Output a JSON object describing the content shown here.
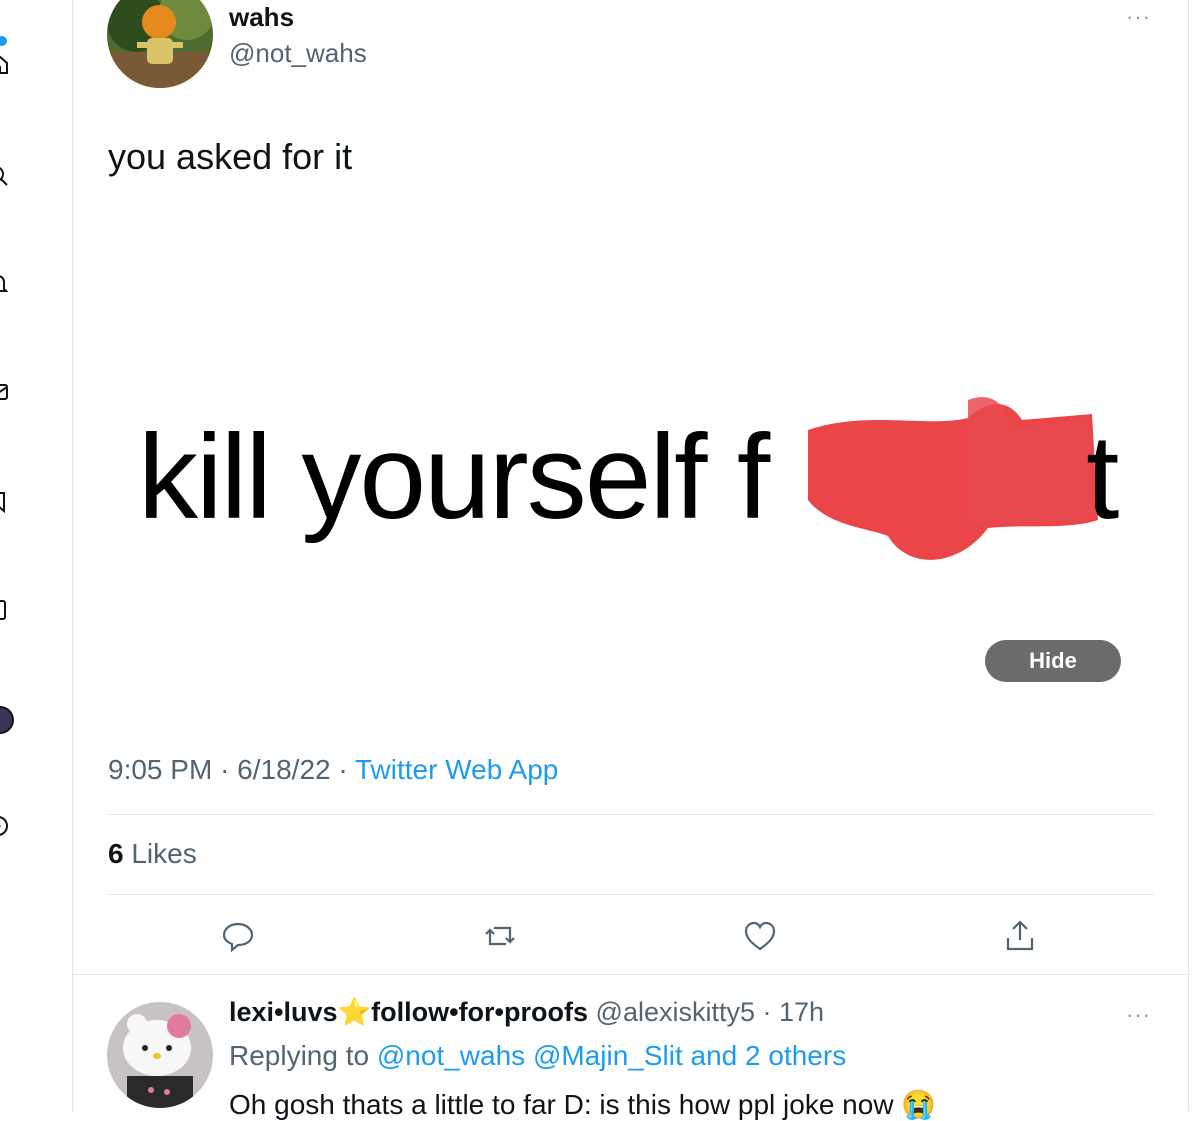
{
  "tweet": {
    "author_name": "wahs",
    "author_handle": "@not_wahs",
    "text": "you asked for it",
    "image_text": "kill yourself f",
    "image_text_end": "t",
    "hide_label": "Hide",
    "time": "9:05 PM",
    "date": "6/18/22",
    "source": "Twitter Web App",
    "likes_count": "6",
    "likes_label": "Likes",
    "more": "···"
  },
  "reply": {
    "author_name": "lexi•luvs⭐follow•for•proofs",
    "author_handle": "@alexiskitty5",
    "time": "17h",
    "replying_prefix": "Replying to",
    "replying_to": "@not_wahs @Majin_Slit and 2 others",
    "text": "Oh gosh thats a little to far D: is this how ppl joke now 😭",
    "more": "···"
  },
  "colors": {
    "accent": "#1d9bf0",
    "redact": "#e8353a"
  },
  "icons": [
    "home-icon",
    "search-icon",
    "bell-icon",
    "mail-icon",
    "bookmark-icon",
    "list-icon",
    "profile-avatar",
    "more-circle-icon",
    "reply-icon",
    "retweet-icon",
    "like-icon",
    "share-icon"
  ]
}
